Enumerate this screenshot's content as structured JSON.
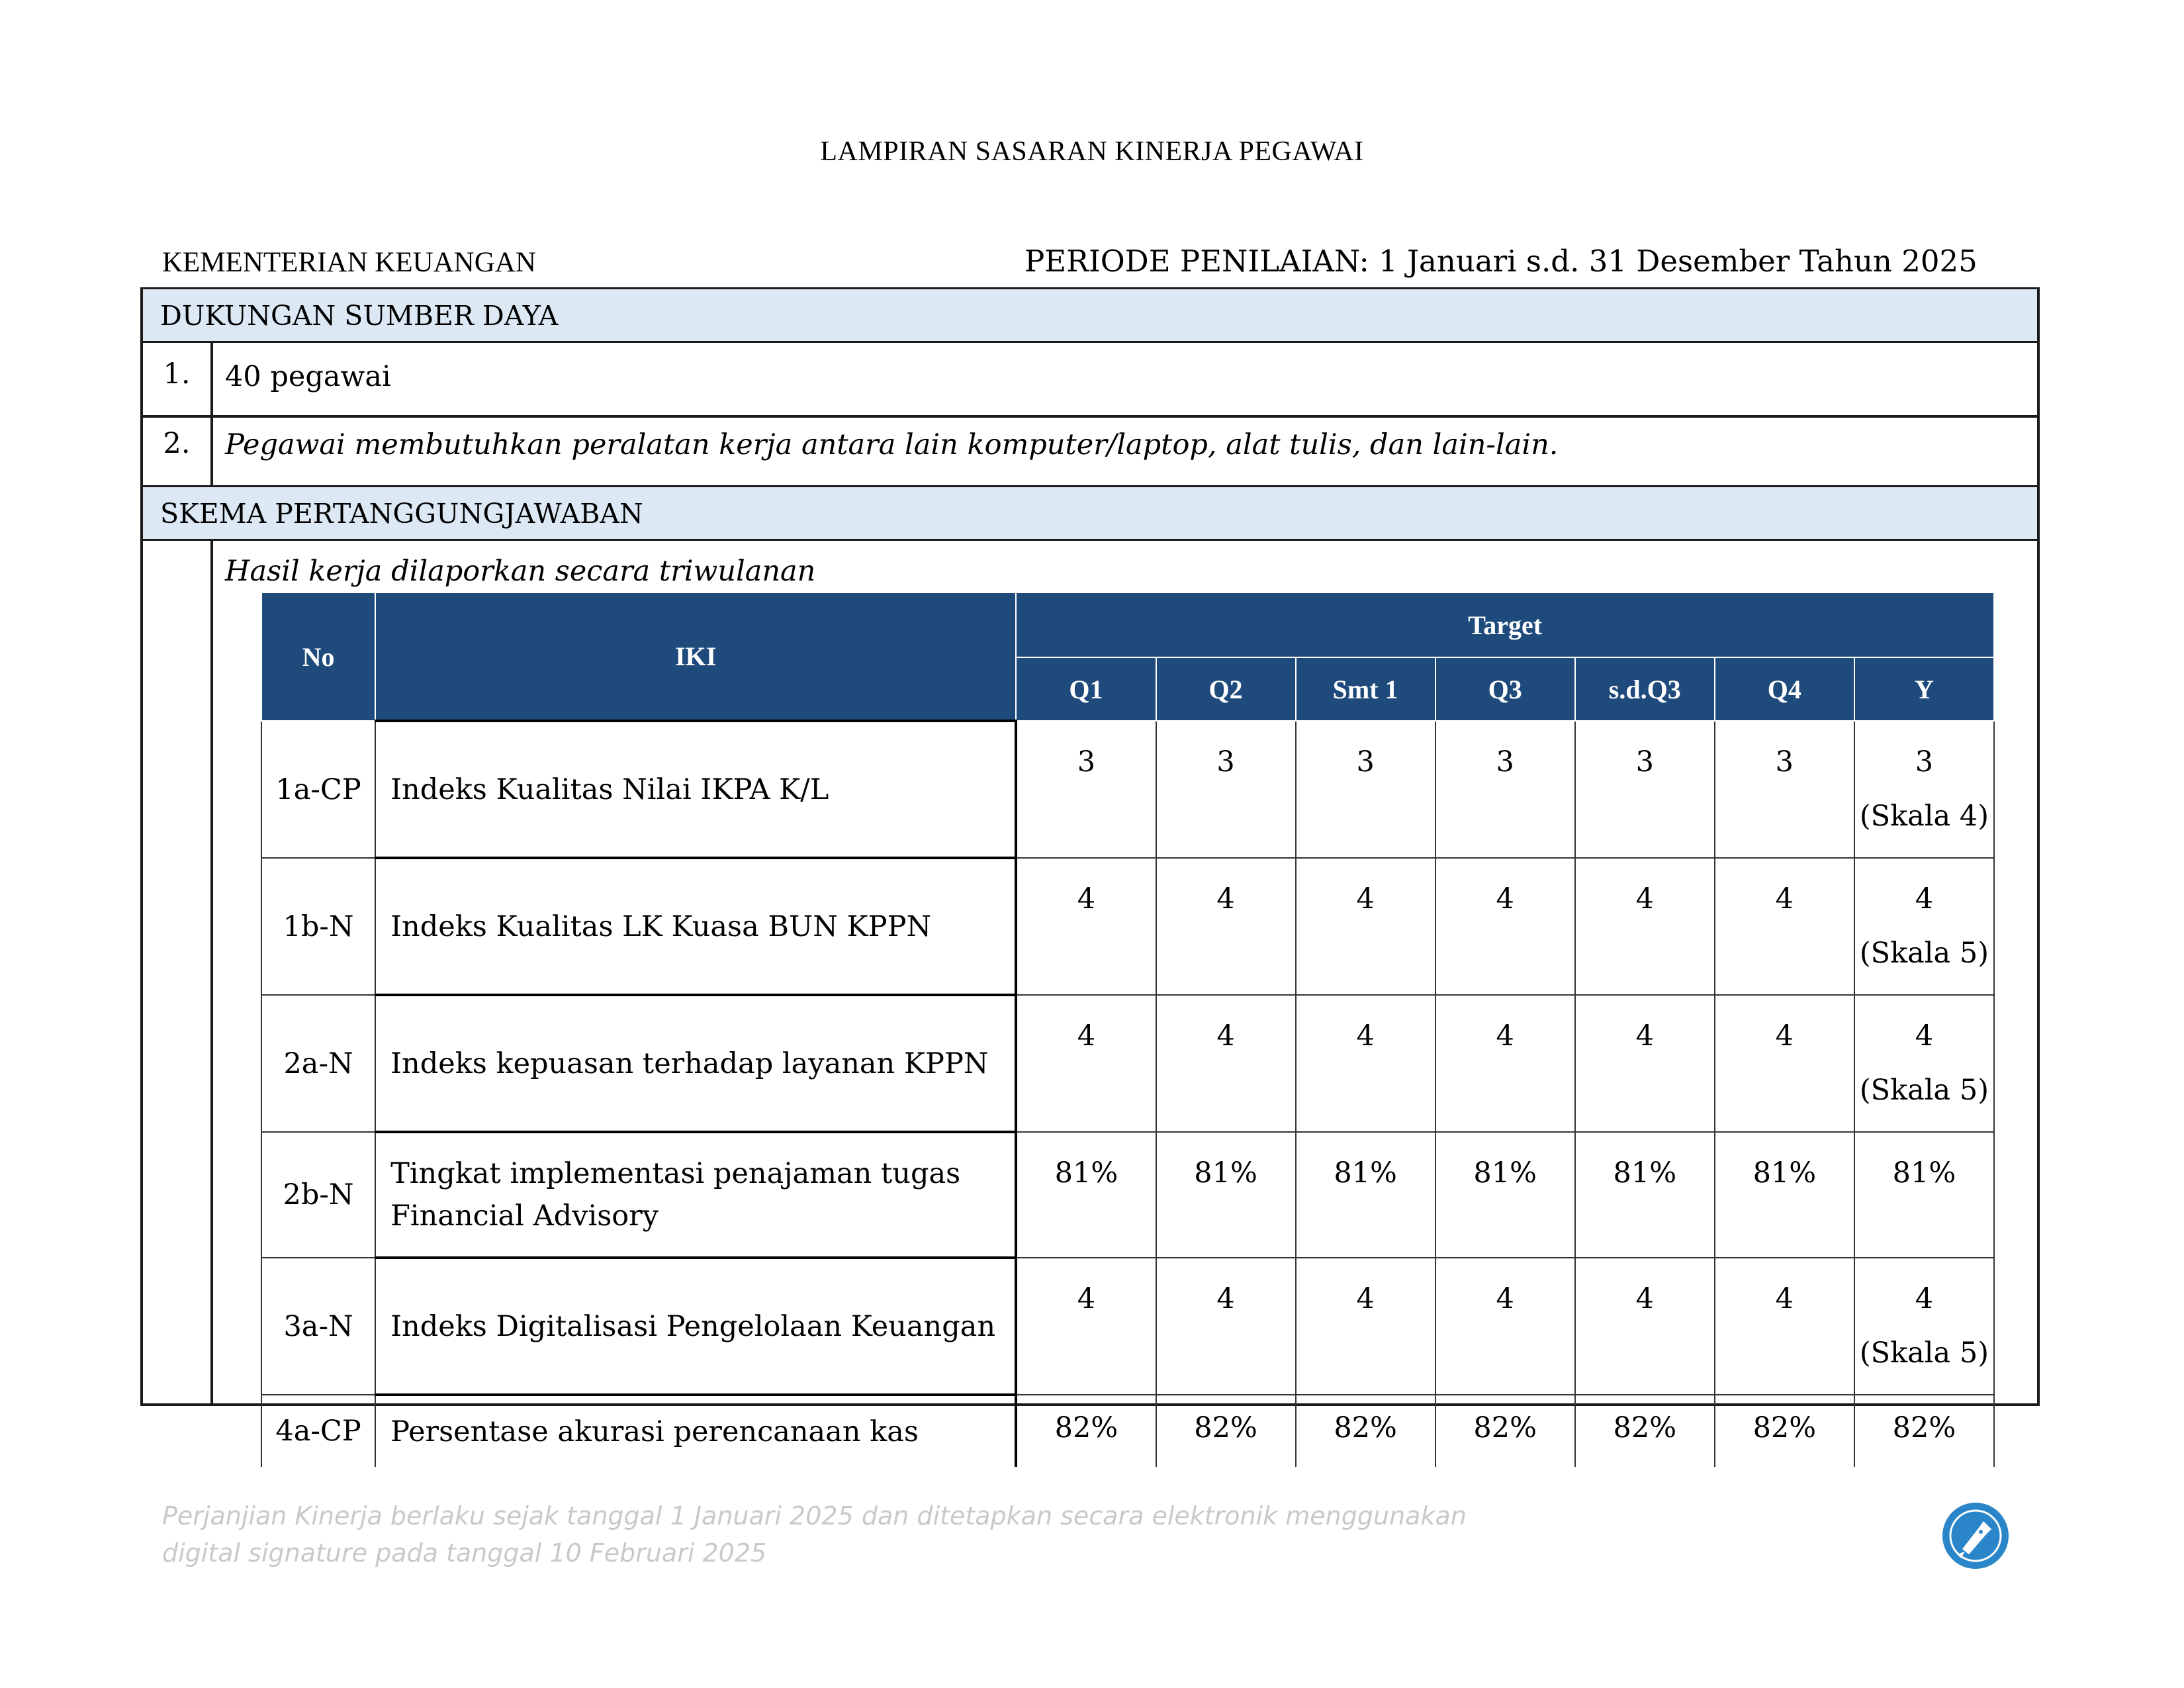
{
  "doc": {
    "title": "LAMPIRAN SASARAN KINERJA PEGAWAI",
    "organization": "KEMENTERIAN KEUANGAN",
    "period": "PERIODE PENILAIAN: 1 Januari s.d. 31 Desember Tahun 2025"
  },
  "dukungan": {
    "heading": "DUKUNGAN SUMBER DAYA",
    "items": [
      {
        "num": "1.",
        "text": "40 pegawai"
      },
      {
        "num": "2.",
        "text": "Pegawai membutuhkan peralatan kerja antara lain komputer/laptop, alat tulis, dan lain-lain."
      }
    ]
  },
  "skema": {
    "heading": "SKEMA PERTANGGUNGJAWABAN",
    "note": "Hasil kerja dilaporkan secara triwulanan"
  },
  "table": {
    "headers": {
      "no": "No",
      "iki": "IKI",
      "target": "Target"
    },
    "subheaders": [
      "Q1",
      "Q2",
      "Smt 1",
      "Q3",
      "s.d.Q3",
      "Q4",
      "Y"
    ],
    "rows": [
      {
        "no": "1a-CP",
        "iki": "Indeks Kualitas Nilai IKPA K/L",
        "values": [
          "3",
          "3",
          "3",
          "3",
          "3",
          "3",
          "3"
        ],
        "scale": "(Skala 4)"
      },
      {
        "no": "1b-N",
        "iki": "Indeks Kualitas LK Kuasa BUN KPPN",
        "values": [
          "4",
          "4",
          "4",
          "4",
          "4",
          "4",
          "4"
        ],
        "scale": "(Skala 5)"
      },
      {
        "no": "2a-N",
        "iki": "Indeks kepuasan terhadap layanan KPPN",
        "values": [
          "4",
          "4",
          "4",
          "4",
          "4",
          "4",
          "4"
        ],
        "scale": "(Skala 5)"
      },
      {
        "no": "2b-N",
        "iki": "Tingkat implementasi penajaman tugas Financial Advisory",
        "values": [
          "81%",
          "81%",
          "81%",
          "81%",
          "81%",
          "81%",
          "81%"
        ],
        "scale": ""
      },
      {
        "no": "3a-N",
        "iki": "Indeks Digitalisasi Pengelolaan Keuangan",
        "values": [
          "4",
          "4",
          "4",
          "4",
          "4",
          "4",
          "4"
        ],
        "scale": "(Skala 5)"
      },
      {
        "no": "4a-CP",
        "iki": "Persentase akurasi perencanaan kas",
        "values": [
          "82%",
          "82%",
          "82%",
          "82%",
          "82%",
          "82%",
          "82%"
        ],
        "scale": ""
      }
    ]
  },
  "footer": {
    "line1": "Perjanjian Kinerja berlaku sejak tanggal 1 Januari 2025 dan ditetapkan secara elektronik menggunakan",
    "line2": "digital signature pada tanggal  10 Februari 2025",
    "seal_icon": "digital-signature-seal-icon"
  },
  "colors": {
    "header_blue": "#1f4a7c",
    "band_blue": "#dce9f5",
    "seal_blue": "#2a86c9",
    "footer_gray": "#c9c9c9"
  }
}
